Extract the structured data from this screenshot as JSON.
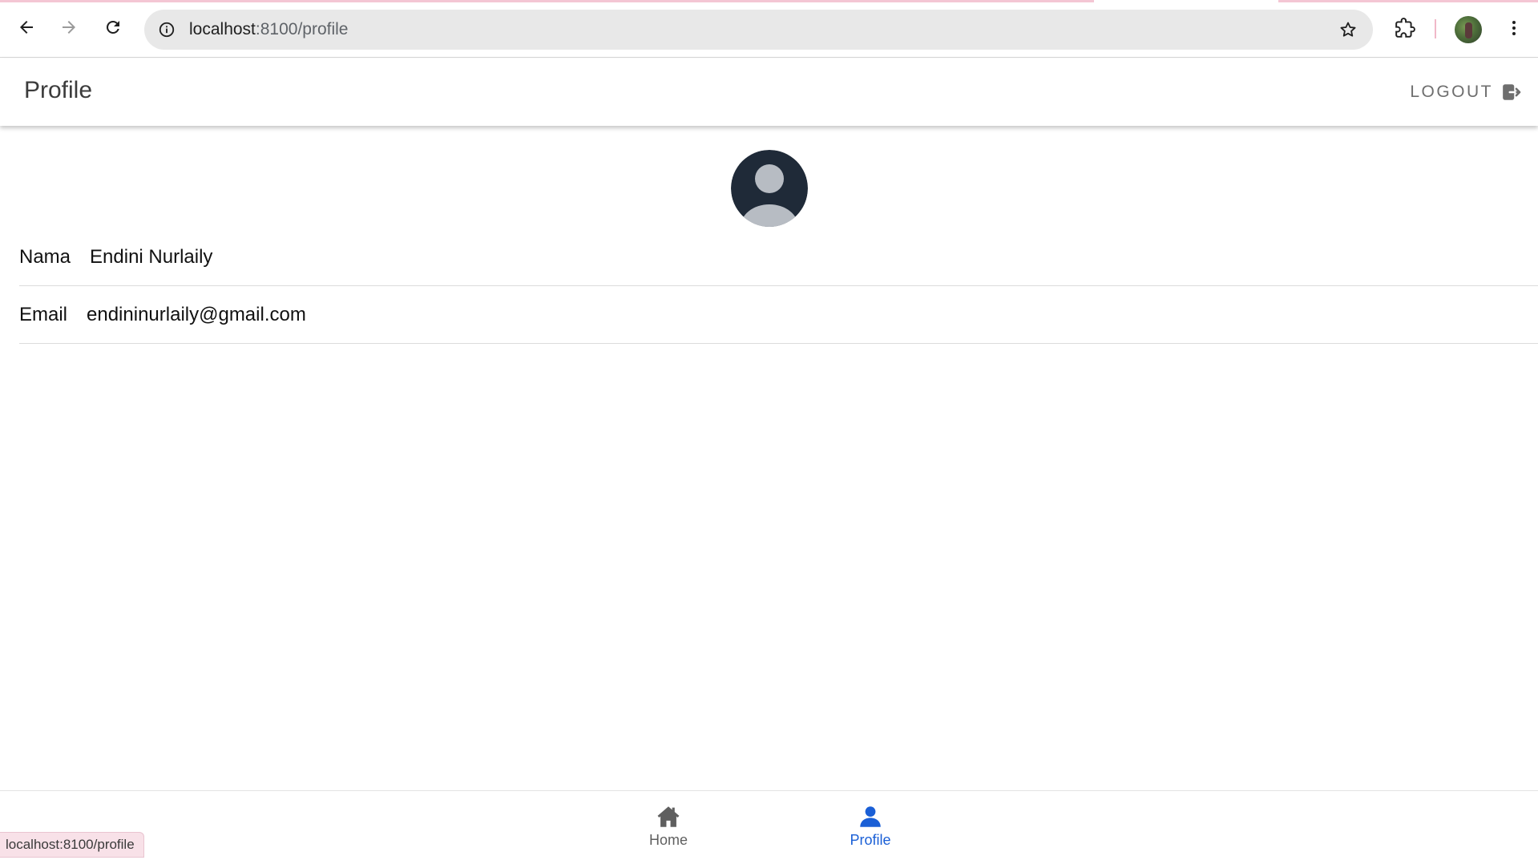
{
  "browser": {
    "url_host": "localhost",
    "url_rest": ":8100/profile"
  },
  "header": {
    "title": "Profile",
    "logout_label": "LOGOUT"
  },
  "profile": {
    "rows": [
      {
        "label": "Nama",
        "value": "Endini Nurlaily"
      },
      {
        "label": "Email",
        "value": "endininurlaily@gmail.com"
      }
    ]
  },
  "tabs": [
    {
      "label": "Home",
      "icon": "home-icon",
      "selected": false
    },
    {
      "label": "Profile",
      "icon": "person-icon",
      "selected": true
    }
  ],
  "status_bar": {
    "text": "localhost:8100/profile"
  },
  "colors": {
    "accent": "#1a5fd6",
    "avatar_dark": "#1f2a38",
    "avatar_light": "#b7bcc3"
  }
}
